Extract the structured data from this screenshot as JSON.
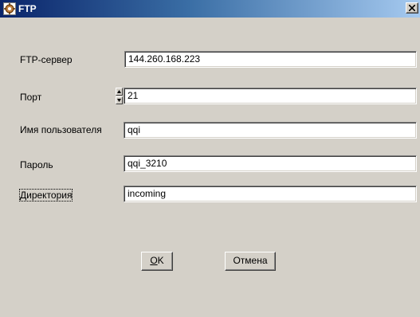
{
  "window": {
    "title": "FTP",
    "close_glyph": "×",
    "icon": "ftp-app-icon"
  },
  "form": {
    "server": {
      "label": "FTP-сервер",
      "value": "144.260.168.223"
    },
    "port": {
      "label": "Порт",
      "value": "21"
    },
    "username": {
      "label": "Имя пользователя",
      "value": "qqi"
    },
    "password": {
      "label": "Пароль",
      "value": "qqi_3210"
    },
    "directory": {
      "label": "Директория",
      "value": "incoming"
    }
  },
  "buttons": {
    "ok": {
      "accel": "O",
      "rest": "K"
    },
    "cancel": {
      "label": "Отмена"
    }
  },
  "colors": {
    "face": "#d4d0c8",
    "title_start": "#0a246a",
    "title_end": "#a6caf0"
  }
}
